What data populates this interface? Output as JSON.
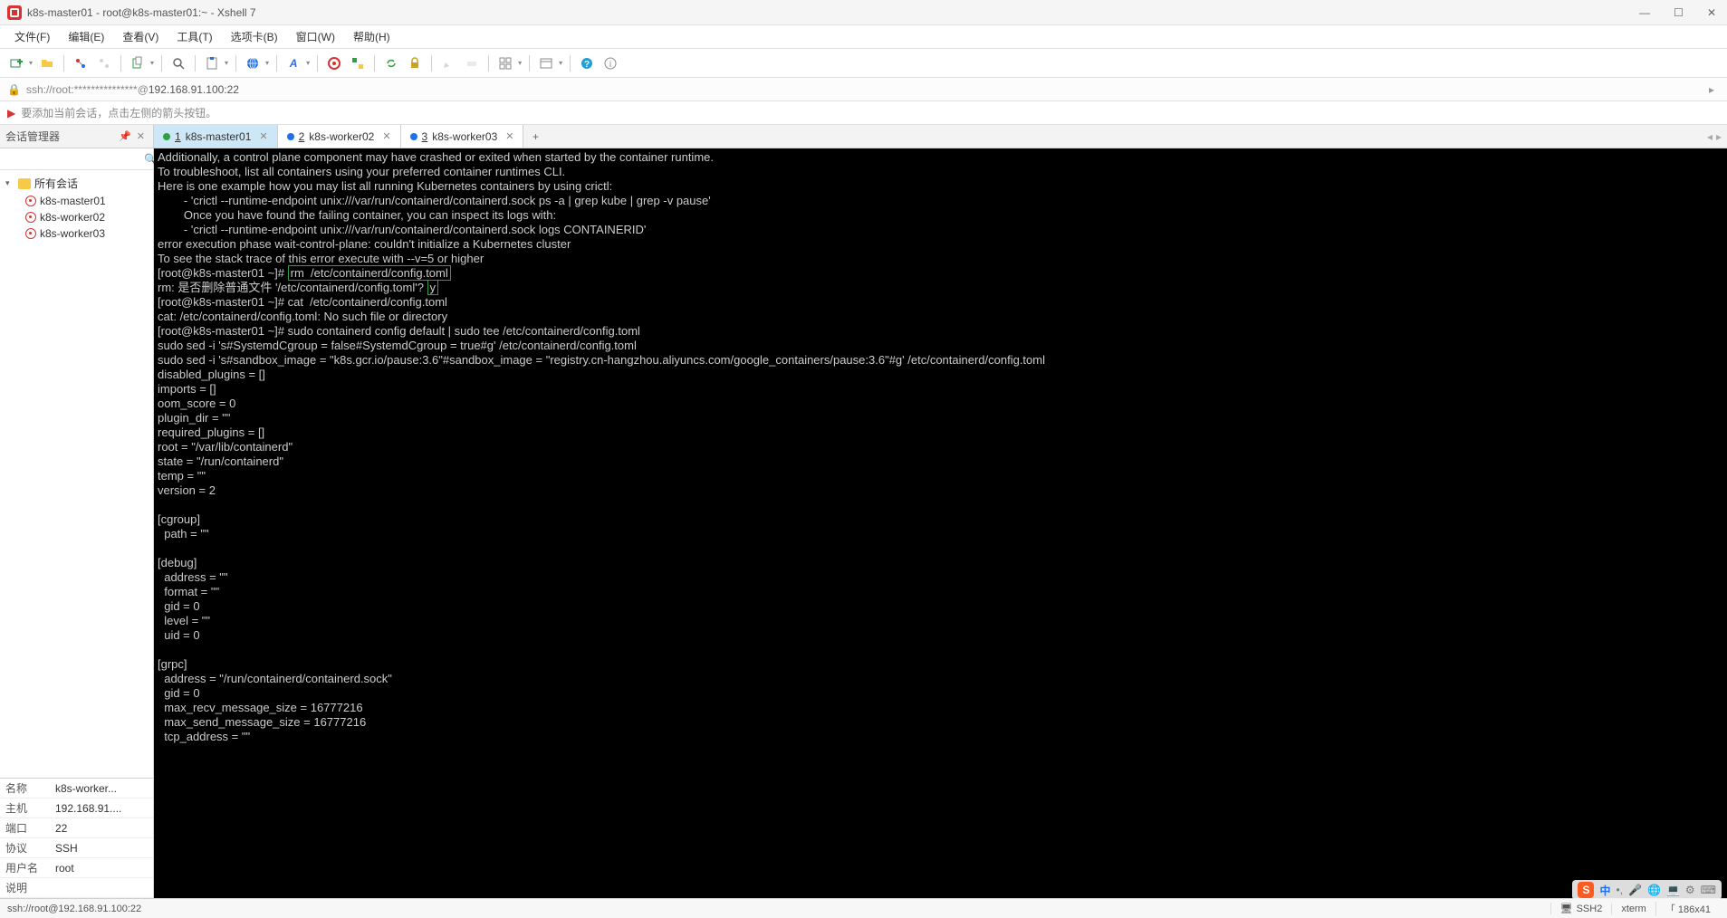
{
  "titlebar": {
    "title": "k8s-master01 - root@k8s-master01:~ - Xshell 7"
  },
  "menu": {
    "items": [
      "文件(F)",
      "编辑(E)",
      "查看(V)",
      "工具(T)",
      "选项卡(B)",
      "窗口(W)",
      "帮助(H)"
    ]
  },
  "addressbar": {
    "text_prefix": "ssh://root:***************@",
    "text_host": "192.168.91.100:22"
  },
  "hintbar": {
    "text": "要添加当前会话，点击左侧的箭头按钮。"
  },
  "session_manager": {
    "title": "会话管理器",
    "root": "所有会话",
    "nodes": [
      "k8s-master01",
      "k8s-worker02",
      "k8s-worker03"
    ]
  },
  "tabs": [
    {
      "num": "1",
      "label": "k8s-master01",
      "status": "green",
      "active": true
    },
    {
      "num": "2",
      "label": "k8s-worker02",
      "status": "blue",
      "active": false
    },
    {
      "num": "3",
      "label": "k8s-worker03",
      "status": "blue",
      "active": false
    }
  ],
  "properties": {
    "rows": [
      {
        "k": "名称",
        "v": "k8s-worker..."
      },
      {
        "k": "主机",
        "v": "192.168.91...."
      },
      {
        "k": "端口",
        "v": "22"
      },
      {
        "k": "协议",
        "v": "SSH"
      },
      {
        "k": "用户名",
        "v": "root"
      },
      {
        "k": "说明",
        "v": ""
      }
    ]
  },
  "terminal": {
    "pre": "Additionally, a control plane component may have crashed or exited when started by the container runtime.\nTo troubleshoot, list all containers using your preferred container runtimes CLI.\nHere is one example how you may list all running Kubernetes containers by using crictl:\n        - 'crictl --runtime-endpoint unix:///var/run/containerd/containerd.sock ps -a | grep kube | grep -v pause'\n        Once you have found the failing container, you can inspect its logs with:\n        - 'crictl --runtime-endpoint unix:///var/run/containerd/containerd.sock logs CONTAINERID'\nerror execution phase wait-control-plane: couldn't initialize a Kubernetes cluster\nTo see the stack trace of this error execute with --v=5 or higher",
    "prompt1": "[root@k8s-master01 ~]# ",
    "cmd1": "rm  /etc/containerd/config.toml",
    "confirm_pre": "rm: 是否删除普通文件 '/etc/containerd/config.toml'? ",
    "confirm_ans": "y",
    "rest": "[root@k8s-master01 ~]# cat  /etc/containerd/config.toml\ncat: /etc/containerd/config.toml: No such file or directory\n[root@k8s-master01 ~]# sudo containerd config default | sudo tee /etc/containerd/config.toml\nsudo sed -i 's#SystemdCgroup = false#SystemdCgroup = true#g' /etc/containerd/config.toml\nsudo sed -i 's#sandbox_image = \"k8s.gcr.io/pause:3.6\"#sandbox_image = \"registry.cn-hangzhou.aliyuncs.com/google_containers/pause:3.6\"#g' /etc/containerd/config.toml\ndisabled_plugins = []\nimports = []\noom_score = 0\nplugin_dir = \"\"\nrequired_plugins = []\nroot = \"/var/lib/containerd\"\nstate = \"/run/containerd\"\ntemp = \"\"\nversion = 2\n\n[cgroup]\n  path = \"\"\n\n[debug]\n  address = \"\"\n  format = \"\"\n  gid = 0\n  level = \"\"\n  uid = 0\n\n[grpc]\n  address = \"/run/containerd/containerd.sock\"\n  gid = 0\n  max_recv_message_size = 16777216\n  max_send_message_size = 16777216\n  tcp_address = \"\""
  },
  "statusbar": {
    "left": "ssh://root@192.168.91.100:22",
    "ssh": "SSH2",
    "term": "xterm",
    "size": "186x41",
    "caps": "「"
  },
  "ime": {
    "zh": "中",
    "items": [
      "•,",
      "🎤",
      "🌐",
      "💻",
      "⚙",
      "⌨"
    ]
  }
}
